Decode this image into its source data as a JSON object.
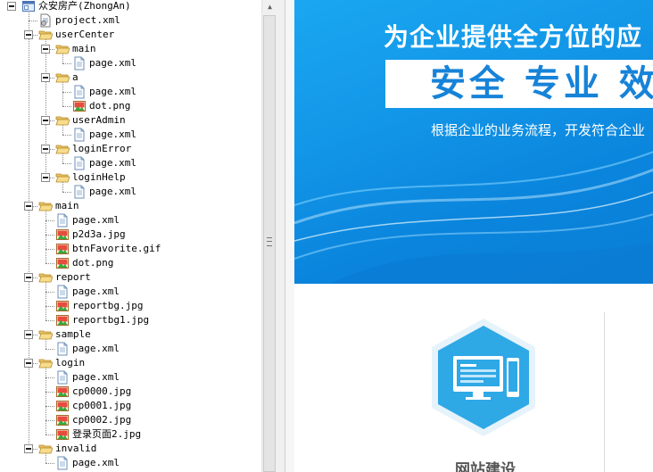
{
  "tree": {
    "nodes": [
      {
        "label": "众安房产(ZhongAn)",
        "icon": "project-icon"
      },
      {
        "label": "project.xml",
        "icon": "xml-config-icon"
      },
      {
        "label": "userCenter",
        "icon": "folder-open-icon"
      },
      {
        "label": "main",
        "icon": "folder-open-icon"
      },
      {
        "label": "page.xml",
        "icon": "file-icon"
      },
      {
        "label": "a",
        "icon": "folder-open-icon"
      },
      {
        "label": "page.xml",
        "icon": "file-icon"
      },
      {
        "label": "dot.png",
        "icon": "image-icon"
      },
      {
        "label": "userAdmin",
        "icon": "folder-open-icon"
      },
      {
        "label": "page.xml",
        "icon": "file-icon"
      },
      {
        "label": "loginError",
        "icon": "folder-open-icon"
      },
      {
        "label": "page.xml",
        "icon": "file-icon"
      },
      {
        "label": "loginHelp",
        "icon": "folder-open-icon"
      },
      {
        "label": "page.xml",
        "icon": "file-icon"
      },
      {
        "label": "main",
        "icon": "folder-open-icon"
      },
      {
        "label": "page.xml",
        "icon": "file-icon"
      },
      {
        "label": "p2d3a.jpg",
        "icon": "image-icon"
      },
      {
        "label": "btnFavorite.gif",
        "icon": "image-icon"
      },
      {
        "label": "dot.png",
        "icon": "image-icon"
      },
      {
        "label": "report",
        "icon": "folder-open-icon"
      },
      {
        "label": "page.xml",
        "icon": "file-icon"
      },
      {
        "label": "reportbg.jpg",
        "icon": "image-icon"
      },
      {
        "label": "reportbg1.jpg",
        "icon": "image-icon"
      },
      {
        "label": "sample",
        "icon": "folder-open-icon"
      },
      {
        "label": "page.xml",
        "icon": "file-icon"
      },
      {
        "label": "login",
        "icon": "folder-open-icon"
      },
      {
        "label": "page.xml",
        "icon": "file-icon"
      },
      {
        "label": "cp0000.jpg",
        "icon": "image-icon"
      },
      {
        "label": "cp0001.jpg",
        "icon": "image-icon"
      },
      {
        "label": "cp0002.jpg",
        "icon": "image-icon"
      },
      {
        "label": "登录页面2.jpg",
        "icon": "image-icon"
      },
      {
        "label": "invalid",
        "icon": "folder-open-icon"
      },
      {
        "label": "page.xml",
        "icon": "file-icon"
      }
    ]
  },
  "scrollbar": {
    "up_arrow_icon": "arrow-up-icon",
    "grip_icon": "grip-icon"
  },
  "preview": {
    "banner_headline": "为企业提供全方位的应",
    "banner_slogan": "安全  专业  效",
    "banner_subtitle": "根据企业的业务流程，开发符合企业",
    "service_title": "网站建设",
    "service_icon": "monitor-phone-icon",
    "colors": {
      "banner": "#1397e8",
      "hexagon": "#2fa8e6",
      "slogan_text": "#1683d8"
    }
  }
}
